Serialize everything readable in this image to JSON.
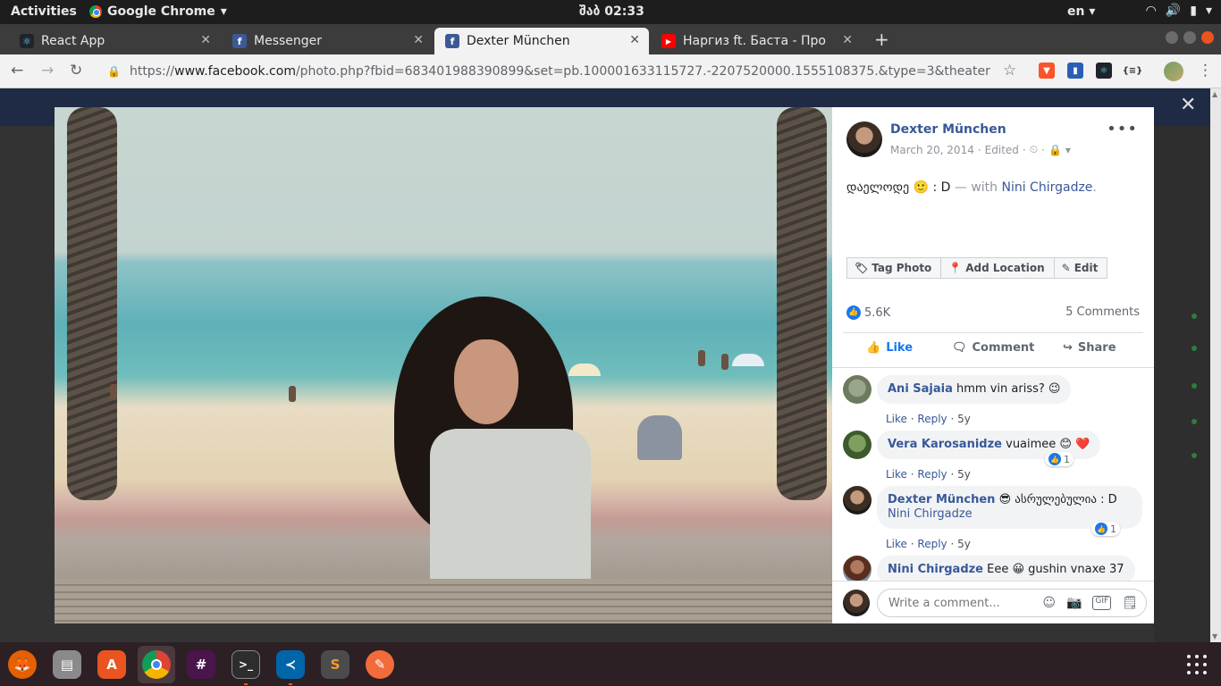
{
  "topbar": {
    "activities": "Activities",
    "app_name": "Google Chrome",
    "clock": "შაბ 02:33",
    "lang": "en"
  },
  "browser": {
    "tabs": [
      {
        "title": "React App",
        "favicon": "react-icon"
      },
      {
        "title": "Messenger",
        "favicon": "facebook-icon"
      },
      {
        "title": "Dexter München",
        "favicon": "facebook-icon",
        "active": true
      },
      {
        "title": "Наргиз ft. Баста - Про",
        "favicon": "youtube-icon"
      }
    ],
    "url_scheme": "https://",
    "url_host": "www.facebook.com",
    "url_path": "/photo.php?fbid=683401988390899&set=pb.100001633115727.-2207520000.1555108375.&type=3&theater"
  },
  "post": {
    "author": "Dexter München",
    "date": "March 20, 2014",
    "edited": "Edited",
    "caption_text": "დაელოდე 🙂 : D",
    "caption_with": "— with",
    "caption_tag": "Nini Chirgadze",
    "caption_end": ".",
    "buttons": {
      "tag_photo": "Tag Photo",
      "add_location": "Add Location",
      "edit": "Edit"
    },
    "reaction_count": "5.6K",
    "comment_count": "5 Comments",
    "bar": {
      "like": "Like",
      "comment": "Comment",
      "share": "Share"
    }
  },
  "comments": [
    {
      "name": "Ani Sajaia",
      "text": "hmm vin ariss? 😉",
      "like": "Like",
      "reply": "Reply",
      "age": "5y"
    },
    {
      "name": "Vera Karosanidze",
      "text": "vuaimee 😊 ❤️",
      "like": "Like",
      "reply": "Reply",
      "age": "5y",
      "reactions": "1"
    },
    {
      "name": "Dexter München",
      "text": "😎 ასრულებულია : D",
      "tag": "Nini Chirgadze",
      "like": "Like",
      "reply": "Reply",
      "age": "5y",
      "reactions": "1"
    },
    {
      "name": "Nini Chirgadze",
      "text": "Eee 😀 gushin vnaxe 37"
    }
  ],
  "composer": {
    "placeholder": "Write a comment..."
  },
  "dock": [
    {
      "name": "firefox-icon",
      "color": "#e66000"
    },
    {
      "name": "files-icon",
      "color": "#8a8a8a"
    },
    {
      "name": "software-center-icon",
      "color": "#e95420"
    },
    {
      "name": "chrome-icon",
      "color": "#4285f4"
    },
    {
      "name": "slack-icon",
      "color": "#4a154b"
    },
    {
      "name": "terminal-icon",
      "color": "#2d2d2d"
    },
    {
      "name": "vscode-icon",
      "color": "#0065a9"
    },
    {
      "name": "sublime-icon",
      "color": "#4b4b4b"
    },
    {
      "name": "pencil-app-icon",
      "color": "#f26b3a"
    }
  ]
}
